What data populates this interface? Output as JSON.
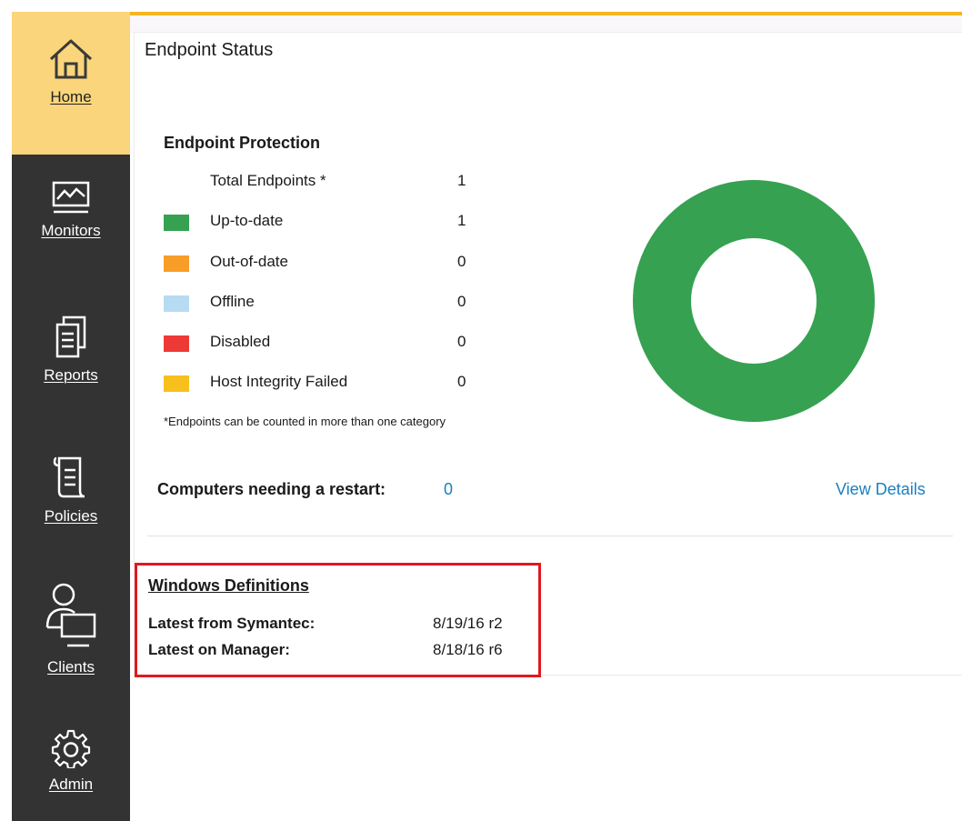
{
  "nav": {
    "items": [
      {
        "label": "Home",
        "icon": "home-icon",
        "active": true
      },
      {
        "label": "Monitors",
        "icon": "monitor-icon",
        "active": false
      },
      {
        "label": "Reports",
        "icon": "reports-icon",
        "active": false
      },
      {
        "label": "Policies",
        "icon": "policies-icon",
        "active": false
      },
      {
        "label": "Clients",
        "icon": "clients-icon",
        "active": false
      },
      {
        "label": "Admin",
        "icon": "gear-icon",
        "active": false
      }
    ]
  },
  "page": {
    "title": "Endpoint Status"
  },
  "protection": {
    "title": "Endpoint Protection",
    "total_label": "Total Endpoints *",
    "total_count": "1",
    "statuses": [
      {
        "label": "Up-to-date",
        "count": "1",
        "color": "#36a151"
      },
      {
        "label": "Out-of-date",
        "count": "0",
        "color": "#f99d29"
      },
      {
        "label": "Offline",
        "count": "0",
        "color": "#b7dbf3"
      },
      {
        "label": "Disabled",
        "count": "0",
        "color": "#ee3a36"
      },
      {
        "label": "Host Integrity Failed",
        "count": "0",
        "color": "#f7c01d"
      }
    ],
    "footnote": "*Endpoints can be counted in more than one category",
    "restart_label": "Computers needing a restart:",
    "restart_count": "0",
    "view_details": "View Details"
  },
  "definitions": {
    "title": "Windows Definitions",
    "rows": [
      {
        "label": "Latest from Symantec:",
        "value": "8/19/16 r2"
      },
      {
        "label": "Latest on Manager:",
        "value": "8/18/16 r6"
      }
    ]
  },
  "colors": {
    "accent": "#f4b520",
    "sidebar": "#333333",
    "active_nav": "#fbd57b",
    "link": "#1a7fc0",
    "highlight_box": "#e0191f",
    "donut": "#36a151"
  }
}
